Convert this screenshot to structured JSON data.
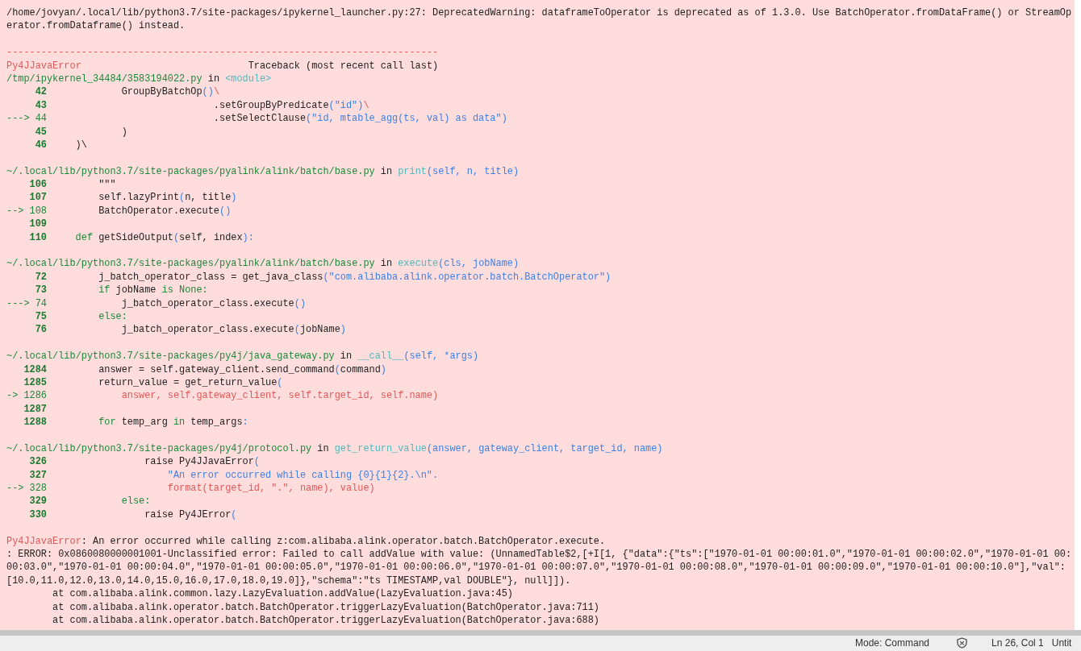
{
  "output": {
    "warning": [
      "/home/jovyan/.local/lib/python3.7/site-packages/ipykernel_launcher.py:27: DeprecatedWarning: dataframeToOperator is deprecated as of 1.3.0. Use BatchOperator.fromDataFrame() or StreamOp",
      "erator.fromDataframe() instead."
    ],
    "separator": "---------------------------------------------------------------------------",
    "exception": {
      "name": "Py4JJavaError",
      "title": "Traceback (most recent call last)"
    },
    "frames": [
      {
        "location": [
          {
            "text": "/tmp/ipykernel_34484/3583194022.py",
            "kind": "green"
          },
          {
            "text": " in ",
            "kind": "plain"
          },
          {
            "text": "<module>",
            "kind": "cyan"
          }
        ],
        "lines": [
          {
            "number": "42",
            "code": [
              {
                "text": "            GroupByBatchOp",
                "kind": "plain"
              },
              {
                "text": "()",
                "kind": "blue"
              },
              {
                "text": "\\",
                "kind": "red"
              }
            ]
          },
          {
            "number": "43",
            "code": [
              {
                "text": "                            .setGroupByPredicate",
                "kind": "plain"
              },
              {
                "text": "(\"id\")",
                "kind": "blue"
              },
              {
                "text": "\\",
                "kind": "red"
              }
            ]
          },
          {
            "marker": "--->",
            "number": "44",
            "code": [
              {
                "text": "                            .setSelectClause",
                "kind": "plain"
              },
              {
                "text": "(\"id, mtable_agg(ts, val) as data\")",
                "kind": "blue"
              }
            ]
          },
          {
            "number": "45",
            "code": [
              {
                "text": "            )",
                "kind": "plain"
              }
            ]
          },
          {
            "number": "46",
            "code": [
              {
                "text": "    )\\",
                "kind": "plain"
              }
            ]
          }
        ]
      },
      {
        "location": [
          {
            "text": "~/.local/lib/python3.7/site-packages/pyalink/alink/batch/base.py",
            "kind": "green"
          },
          {
            "text": " in ",
            "kind": "plain"
          },
          {
            "text": "print",
            "kind": "cyan"
          },
          {
            "text": "(self, n, title)",
            "kind": "blue"
          }
        ],
        "lines": [
          {
            "number": "106",
            "code": [
              {
                "text": "        \"\"\"",
                "kind": "plain"
              }
            ]
          },
          {
            "number": "107",
            "code": [
              {
                "text": "        self.lazyPrint",
                "kind": "plain"
              },
              {
                "text": "(",
                "kind": "blue"
              },
              {
                "text": "n, title",
                "kind": "plain"
              },
              {
                "text": ")",
                "kind": "blue"
              }
            ]
          },
          {
            "marker": "-->",
            "number": "108",
            "code": [
              {
                "text": "        BatchOperator.execute",
                "kind": "plain"
              },
              {
                "text": "()",
                "kind": "blue"
              }
            ]
          },
          {
            "number": "109"
          },
          {
            "number": "110",
            "code": [
              {
                "text": "    def",
                "kind": "green"
              },
              {
                "text": " getSideOutput",
                "kind": "plain"
              },
              {
                "text": "(",
                "kind": "blue"
              },
              {
                "text": "self, index",
                "kind": "plain"
              },
              {
                "text": "):",
                "kind": "blue"
              }
            ]
          }
        ]
      },
      {
        "location": [
          {
            "text": "~/.local/lib/python3.7/site-packages/pyalink/alink/batch/base.py",
            "kind": "green"
          },
          {
            "text": " in ",
            "kind": "plain"
          },
          {
            "text": "execute",
            "kind": "cyan"
          },
          {
            "text": "(cls, jobName)",
            "kind": "blue"
          }
        ],
        "lines": [
          {
            "number": "72",
            "code": [
              {
                "text": "        j_batch_operator_class = get_java_class",
                "kind": "plain"
              },
              {
                "text": "(\"com.alibaba.alink.operator.batch.BatchOperator\")",
                "kind": "blue"
              }
            ]
          },
          {
            "number": "73",
            "code": [
              {
                "text": "        if",
                "kind": "green"
              },
              {
                "text": " jobName ",
                "kind": "plain"
              },
              {
                "text": "is None:",
                "kind": "green"
              }
            ]
          },
          {
            "marker": "--->",
            "number": "74",
            "code": [
              {
                "text": "            j_batch_operator_class.execute",
                "kind": "plain"
              },
              {
                "text": "()",
                "kind": "blue"
              }
            ]
          },
          {
            "number": "75",
            "code": [
              {
                "text": "        else:",
                "kind": "green"
              }
            ]
          },
          {
            "number": "76",
            "code": [
              {
                "text": "            j_batch_operator_class.execute",
                "kind": "plain"
              },
              {
                "text": "(",
                "kind": "blue"
              },
              {
                "text": "jobName",
                "kind": "plain"
              },
              {
                "text": ")",
                "kind": "blue"
              }
            ]
          }
        ]
      },
      {
        "location": [
          {
            "text": "~/.local/lib/python3.7/site-packages/py4j/java_gateway.py",
            "kind": "green"
          },
          {
            "text": " in ",
            "kind": "plain"
          },
          {
            "text": "__call__",
            "kind": "cyan"
          },
          {
            "text": "(self, *args)",
            "kind": "blue"
          }
        ],
        "lines": [
          {
            "number": "1284",
            "code": [
              {
                "text": "        answer = self.gateway_client.send_command",
                "kind": "plain"
              },
              {
                "text": "(",
                "kind": "blue"
              },
              {
                "text": "command",
                "kind": "plain"
              },
              {
                "text": ")",
                "kind": "blue"
              }
            ]
          },
          {
            "number": "1285",
            "code": [
              {
                "text": "        return_value = get_return_value",
                "kind": "plain"
              },
              {
                "text": "(",
                "kind": "blue"
              }
            ]
          },
          {
            "marker": "->",
            "number": "1286",
            "code": [
              {
                "text": "            answer, self.gateway_client, self.target_id, self.name)",
                "kind": "red"
              }
            ]
          },
          {
            "number": "1287"
          },
          {
            "number": "1288",
            "code": [
              {
                "text": "        for",
                "kind": "green"
              },
              {
                "text": " temp_arg ",
                "kind": "plain"
              },
              {
                "text": "in",
                "kind": "green"
              },
              {
                "text": " temp_args",
                "kind": "plain"
              },
              {
                "text": ":",
                "kind": "blue"
              }
            ]
          }
        ]
      },
      {
        "location": [
          {
            "text": "~/.local/lib/python3.7/site-packages/py4j/protocol.py",
            "kind": "green"
          },
          {
            "text": " in ",
            "kind": "plain"
          },
          {
            "text": "get_return_value",
            "kind": "cyan"
          },
          {
            "text": "(answer, gateway_client, target_id, name)",
            "kind": "blue"
          }
        ],
        "lines": [
          {
            "number": "326",
            "code": [
              {
                "text": "                raise Py4JJavaError",
                "kind": "plain"
              },
              {
                "text": "(",
                "kind": "blue"
              }
            ]
          },
          {
            "number": "327",
            "code": [
              {
                "text": "                    \"An error occurred while calling {0}{1}{2}.\\n\".",
                "kind": "blue"
              }
            ]
          },
          {
            "marker": "-->",
            "number": "328",
            "code": [
              {
                "text": "                    format(target_id, \".\", name), value)",
                "kind": "red"
              }
            ]
          },
          {
            "number": "329",
            "code": [
              {
                "text": "            else:",
                "kind": "green"
              }
            ]
          },
          {
            "number": "330",
            "code": [
              {
                "text": "                raise Py4JError",
                "kind": "plain"
              },
              {
                "text": "(",
                "kind": "blue"
              }
            ]
          }
        ]
      }
    ],
    "error": {
      "name": "Py4JJavaError",
      "message": ": An error occurred while calling z:com.alibaba.alink.operator.batch.BatchOperator.execute.",
      "details": [
        ": ERROR: 0x0860080000001001-Unclassified error: Failed to call addValue with value: (UnnamedTable$2,[+I[1, {\"data\":{\"ts\":[\"1970-01-01 00:00:01.0\",\"1970-01-01 00:00:02.0\",\"1970-01-01 00:",
        "00:03.0\",\"1970-01-01 00:00:04.0\",\"1970-01-01 00:00:05.0\",\"1970-01-01 00:00:06.0\",\"1970-01-01 00:00:07.0\",\"1970-01-01 00:00:08.0\",\"1970-01-01 00:00:09.0\",\"1970-01-01 00:00:10.0\"],\"val\":",
        "[10.0,11.0,12.0,13.0,14.0,15.0,16.0,17.0,18.0,19.0]},\"schema\":\"ts TIMESTAMP,val DOUBLE\"}, null]]).",
        "        at com.alibaba.alink.common.lazy.LazyEvaluation.addValue(LazyEvaluation.java:45)",
        "        at com.alibaba.alink.operator.batch.BatchOperator.triggerLazyEvaluation(BatchOperator.java:711)",
        "        at com.alibaba.alink.operator.batch.BatchOperator.triggerLazyEvaluation(BatchOperator.java:688)"
      ]
    }
  },
  "status_bar": {
    "mode": "Mode: Command",
    "position": "Ln 26, Col 1",
    "document": "Untit"
  }
}
